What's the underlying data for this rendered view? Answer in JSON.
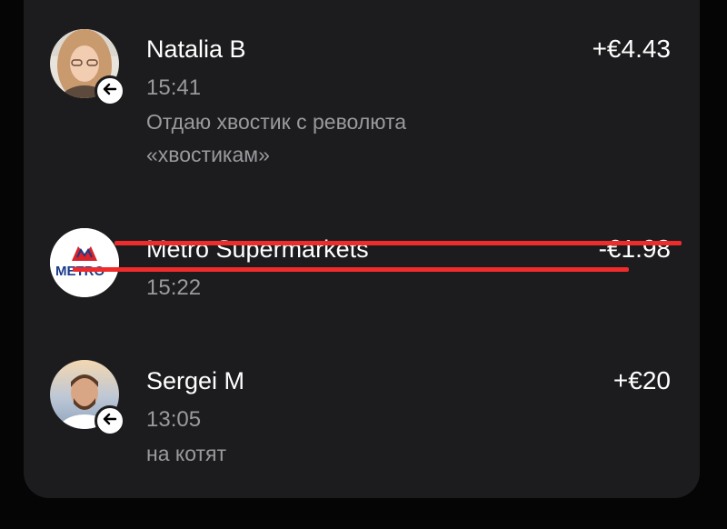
{
  "colors": {
    "card_background": "#1c1c1e",
    "primary_text": "#ffffff",
    "secondary_text": "#9a9a9e",
    "strike_line": "#ef2b2b"
  },
  "transactions": [
    {
      "name": "Natalia B",
      "time": "15:41",
      "amount": "+€4.43",
      "note": "Отдаю хвостик с революта «хвостикам»",
      "direction_icon": "arrow-left-icon"
    },
    {
      "name": "Metro Supermarkets",
      "time": "15:22",
      "amount": "-€1.98",
      "logo_text": "METRO",
      "logo_icon": "metro-logo-icon"
    },
    {
      "name": "Sergei M",
      "time": "13:05",
      "amount": "+€20",
      "note": "на котят",
      "direction_icon": "arrow-left-icon"
    }
  ]
}
